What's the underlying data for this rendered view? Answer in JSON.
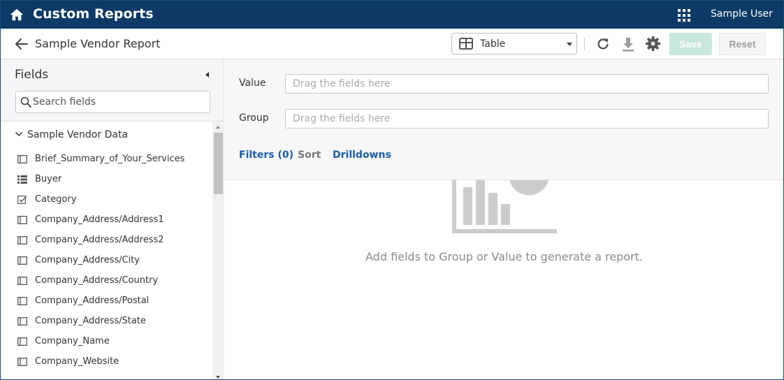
{
  "app": {
    "title": "Custom Reports",
    "user_name": "Sample User"
  },
  "header": {
    "report_title": "Sample Vendor Report",
    "view_select_value": "Table",
    "save_label": "Save",
    "reset_label": "Reset"
  },
  "sidebar": {
    "title": "Fields",
    "search_placeholder": "Search fields",
    "group_label": "Sample Vendor Data",
    "fields": [
      {
        "label": "Brief_Summary_of_Your_Services",
        "icon": "text-field-icon"
      },
      {
        "label": "Buyer",
        "icon": "list-field-icon"
      },
      {
        "label": "Category",
        "icon": "checkbox-field-icon"
      },
      {
        "label": "Company_Address/Address1",
        "icon": "text-field-icon"
      },
      {
        "label": "Company_Address/Address2",
        "icon": "text-field-icon"
      },
      {
        "label": "Company_Address/City",
        "icon": "text-field-icon"
      },
      {
        "label": "Company_Address/Country",
        "icon": "text-field-icon"
      },
      {
        "label": "Company_Address/Postal",
        "icon": "text-field-icon"
      },
      {
        "label": "Company_Address/State",
        "icon": "text-field-icon"
      },
      {
        "label": "Company_Name",
        "icon": "text-field-icon"
      },
      {
        "label": "Company_Website",
        "icon": "text-field-icon"
      }
    ]
  },
  "config": {
    "value_label": "Value",
    "value_placeholder": "Drag the fields here",
    "group_label": "Group",
    "group_placeholder": "Drag the fields here",
    "tabs": {
      "filters": "Filters (0)",
      "sort": "Sort",
      "drilldowns": "Drilldowns"
    }
  },
  "empty_state": {
    "message": "Add fields to Group or Value to generate a report."
  },
  "colors": {
    "topbar": "#0d3a66",
    "link": "#1a5ea8",
    "save_disabled": "#c9e6dd"
  }
}
